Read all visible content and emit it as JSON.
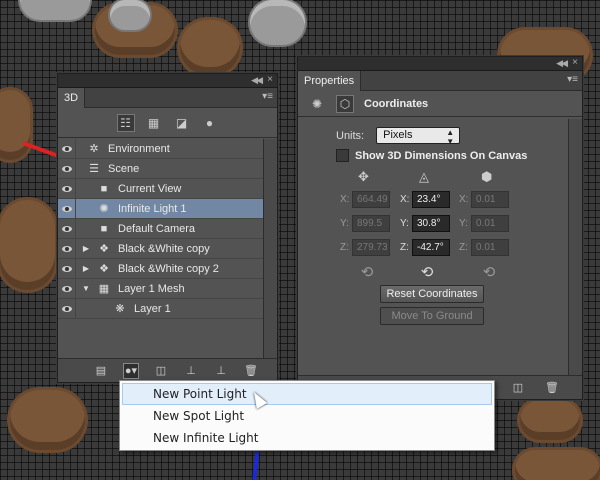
{
  "panel3d": {
    "tab_label": "3D",
    "filter_buttons": [
      "scene-filter-icon",
      "mesh-filter-icon",
      "material-filter-icon",
      "light-filter-icon"
    ],
    "layers": [
      {
        "label": "Environment",
        "icon": "environment-icon",
        "indent": 0,
        "expander": ""
      },
      {
        "label": "Scene",
        "icon": "scene-icon",
        "indent": 0,
        "expander": ""
      },
      {
        "label": "Current View",
        "icon": "camera-icon",
        "indent": 1,
        "expander": ""
      },
      {
        "label": "Infinite Light 1",
        "icon": "infinite-light-icon",
        "indent": 1,
        "expander": "",
        "selected": true
      },
      {
        "label": "Default Camera",
        "icon": "camera-icon",
        "indent": 1,
        "expander": ""
      },
      {
        "label": "Black &White copy",
        "icon": "mesh-icon",
        "indent": 1,
        "expander": "▶"
      },
      {
        "label": "Black &White copy 2",
        "icon": "mesh-icon",
        "indent": 1,
        "expander": "▶"
      },
      {
        "label": "Layer 1 Mesh",
        "icon": "mesh-icon",
        "indent": 1,
        "expander": "▼"
      },
      {
        "label": "Layer 1",
        "icon": "material-icon",
        "indent": 2,
        "expander": ""
      }
    ],
    "bottom_buttons": [
      "render-icon",
      "add-light-icon",
      "new-mesh-icon",
      "ground-icon",
      "material-icon",
      "delete-icon"
    ]
  },
  "properties": {
    "tab_label": "Properties",
    "section_title": "Coordinates",
    "units_label": "Units:",
    "units_value": "Pixels",
    "show_dimensions_label": "Show 3D Dimensions On Canvas",
    "position": {
      "x": "664.49",
      "y": "899.5",
      "z": "279.73"
    },
    "rotation": {
      "x": "23.4°",
      "y": "30.8°",
      "z": "-42.7°"
    },
    "scale": {
      "x": "0.01",
      "y": "0.01",
      "z": "0.01"
    },
    "axis_labels": {
      "x": "X:",
      "y": "Y:",
      "z": "Z:"
    },
    "reset_coordinates_label": "Reset Coordinates",
    "move_to_ground_label": "Move To Ground"
  },
  "menu": {
    "items": [
      "New Point Light",
      "New Spot Light",
      "New Infinite Light"
    ],
    "hovered_index": 0
  },
  "colors": {
    "selection": "#7187a3",
    "menu_hover": "#e3eefb"
  }
}
